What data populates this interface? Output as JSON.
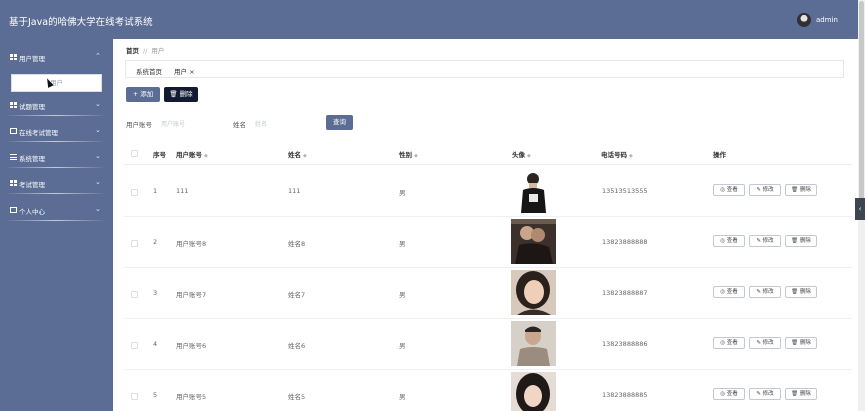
{
  "app": {
    "title": "基于Java的哈佛大学在线考试系统",
    "username": "admin"
  },
  "sidebar": {
    "items": [
      {
        "label": "用户管理",
        "icon": "grid-icon",
        "chevron": "⌃"
      },
      {
        "label": "试题管理",
        "icon": "grid-icon",
        "chevron": "⌄"
      },
      {
        "label": "在线考试管理",
        "icon": "document-icon",
        "chevron": "⌄"
      },
      {
        "label": "系统管理",
        "icon": "list-icon",
        "chevron": "⌄"
      },
      {
        "label": "考试管理",
        "icon": "grid-icon",
        "chevron": "⌄"
      },
      {
        "label": "个人中心",
        "icon": "card-icon",
        "chevron": "⌄"
      }
    ],
    "submenu_active": "用户"
  },
  "breadcrumb": {
    "home": "首页",
    "separator": "//",
    "current": "用户"
  },
  "tags": {
    "home": "系统首页",
    "active": "用户 ×"
  },
  "toolbar": {
    "add_label": "+ 添加",
    "delete_label": "🗑 删除"
  },
  "search": {
    "account_label": "用户账号",
    "account_placeholder": "用户账号",
    "name_label": "姓名",
    "name_placeholder": "姓名",
    "query_label": "查询"
  },
  "table": {
    "columns": {
      "index": "序号",
      "account": "用户账号",
      "name": "姓名",
      "gender": "性别",
      "avatar": "头像",
      "phone": "电话号码",
      "actions": "操作"
    },
    "actions": {
      "view": "◎ 查看",
      "edit": "✎ 修改",
      "delete": "🗑 删除"
    },
    "rows": [
      {
        "index": "1",
        "account": "111",
        "name": "111",
        "gender": "男",
        "phone": "13513513555"
      },
      {
        "index": "2",
        "account": "用户账号8",
        "name": "姓名8",
        "gender": "男",
        "phone": "13823888888"
      },
      {
        "index": "3",
        "account": "用户账号7",
        "name": "姓名7",
        "gender": "男",
        "phone": "13823888887"
      },
      {
        "index": "4",
        "account": "用户账号6",
        "name": "姓名6",
        "gender": "男",
        "phone": "13823888886"
      },
      {
        "index": "5",
        "account": "用户账号5",
        "name": "姓名5",
        "gender": "男",
        "phone": "13823888885"
      }
    ]
  },
  "colors": {
    "primary": "#5b6d94",
    "dark_button": "#131a33",
    "border": "#dcdfe6"
  }
}
